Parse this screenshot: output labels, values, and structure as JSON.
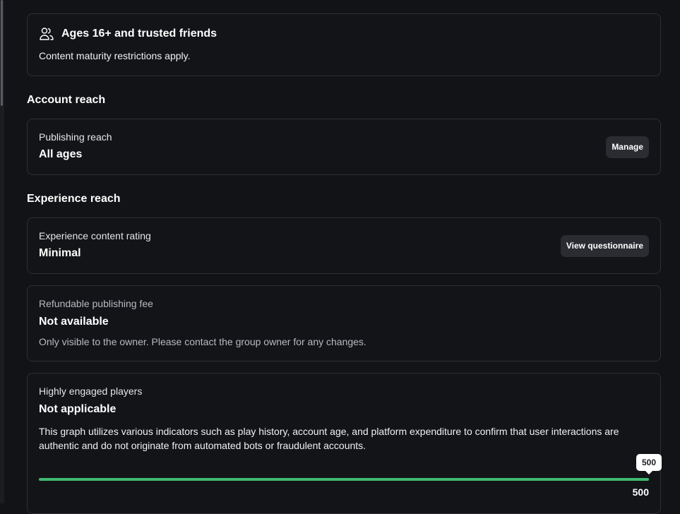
{
  "age_card": {
    "icon": "people-icon",
    "title": "Ages 16+ and trusted friends",
    "description": "Content maturity restrictions apply."
  },
  "account_reach": {
    "section_title": "Account reach",
    "label": "Publishing reach",
    "value": "All ages",
    "button": "Manage"
  },
  "experience_reach": {
    "section_title": "Experience reach",
    "label": "Experience content rating",
    "value": "Minimal",
    "button": "View questionnaire"
  },
  "publishing_fee": {
    "label": "Refundable publishing fee",
    "value": "Not available",
    "note": "Only visible to the owner. Please contact the group owner for any changes."
  },
  "engaged_players": {
    "label": "Highly engaged players",
    "value": "Not applicable",
    "description": "This graph utilizes various indicators such as play history, account age, and platform expenditure to confirm that user interactions are authentic and do not originate from automated bots or fraudulent accounts.",
    "slider_value": "500",
    "slider_max": "500",
    "slider_fraction": 1.0
  },
  "colors": {
    "background": "#121316",
    "card_border": "#2d2f35",
    "button_bg": "#2a2c32",
    "slider_fill": "#3fb96e"
  }
}
